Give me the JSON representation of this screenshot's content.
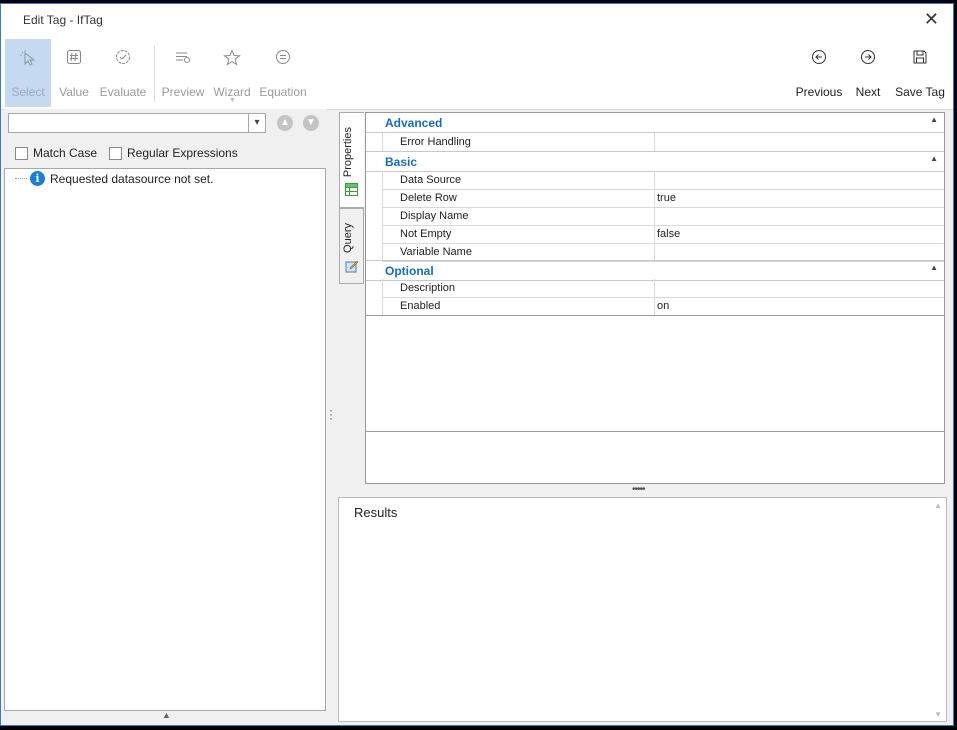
{
  "window": {
    "title": "Edit Tag - IfTag"
  },
  "toolbar": {
    "select": "Select",
    "value": "Value",
    "evaluate": "Evaluate",
    "preview": "Preview",
    "wizard": "Wizard",
    "equation": "Equation",
    "previous": "Previous",
    "next": "Next",
    "save": "Save Tag"
  },
  "left": {
    "search_value": "",
    "match_case": "Match Case",
    "regex": "Regular Expressions",
    "tree_message": "Requested datasource not set."
  },
  "tabs": {
    "properties": "Properties",
    "query": "Query"
  },
  "grid": {
    "advanced": {
      "label": "Advanced",
      "rows": [
        {
          "name": "Error Handling",
          "value": ""
        }
      ]
    },
    "basic": {
      "label": "Basic",
      "rows": [
        {
          "name": "Data Source",
          "value": ""
        },
        {
          "name": "Delete Row",
          "value": "true"
        },
        {
          "name": "Display Name",
          "value": ""
        },
        {
          "name": "Not Empty",
          "value": "false"
        },
        {
          "name": "Variable Name",
          "value": ""
        }
      ]
    },
    "optional": {
      "label": "Optional",
      "rows": [
        {
          "name": "Description",
          "value": ""
        },
        {
          "name": "Enabled",
          "value": "on"
        }
      ]
    }
  },
  "results": {
    "label": "Results"
  }
}
